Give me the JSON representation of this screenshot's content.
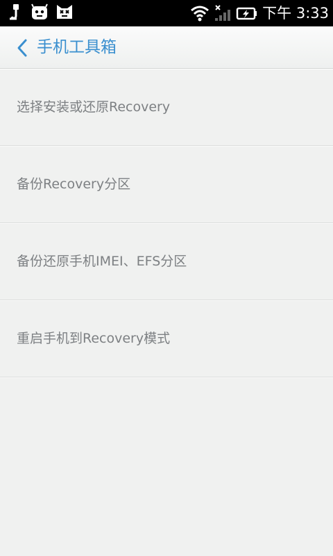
{
  "status_bar": {
    "time": "下午 3:33",
    "left_icons": [
      "usb-icon",
      "android-face-icon",
      "cat-icon"
    ],
    "right_icons": [
      "wifi-icon",
      "signal-icon",
      "battery-charging-icon"
    ]
  },
  "header": {
    "back_icon": "chevron-left-icon",
    "title": "手机工具箱",
    "accent_color": "#3a8fcf"
  },
  "menu": {
    "items": [
      {
        "label": "选择安装或还原Recovery"
      },
      {
        "label": "备份Recovery分区"
      },
      {
        "label": "备份还原手机IMEI、EFS分区"
      },
      {
        "label": "重启手机到Recovery模式"
      }
    ]
  }
}
